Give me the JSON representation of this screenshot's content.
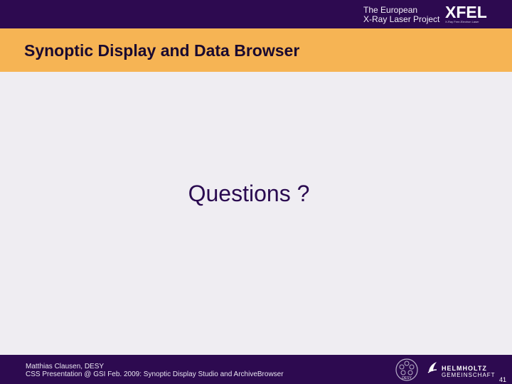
{
  "header": {
    "project_line1": "The European",
    "project_line2": "X-Ray Laser Project",
    "logo_text": "XFEL",
    "logo_subtext": "X-Ray Free-Electron Laser"
  },
  "title": "Synoptic Display and Data Browser",
  "body": {
    "text": "Questions ?"
  },
  "footer": {
    "author": "Matthias Clausen, DESY",
    "event": "CSS Presentation @ GSI Feb. 2009: Synoptic Display Studio and ArchiveBrowser",
    "desy_logo_text": "DESY",
    "helmholtz_line1": "HELMHOLTZ",
    "helmholtz_line2": "GEMEINSCHAFT",
    "page_number": "41"
  },
  "colors": {
    "header_bg": "#2d0a50",
    "title_bar": "#f6b454",
    "content_bg": "#efedf2"
  }
}
